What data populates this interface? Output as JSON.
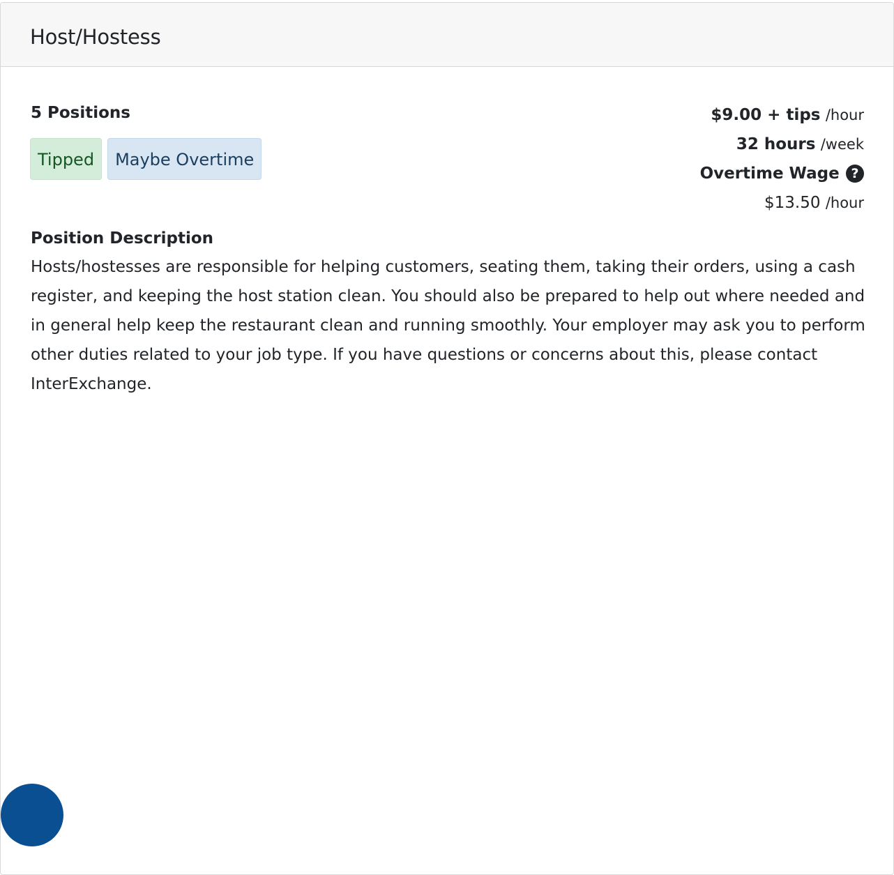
{
  "job": {
    "title": "Host/Hostess",
    "positions": "5 Positions",
    "badges": [
      "Tipped",
      "Maybe Overtime"
    ],
    "wage": {
      "amount": "$9.00 + tips",
      "unit": "/hour"
    },
    "hours": {
      "amount": "32 hours",
      "unit": "/week"
    },
    "overtime": {
      "label": "Overtime Wage",
      "help_icon": "question-circle-icon",
      "amount": "$13.50",
      "unit": "/hour"
    },
    "description": {
      "heading": "Position Description",
      "text": "Hosts/hostesses are responsible for helping customers, seating them, taking their orders, using a cash register, and keeping the host station clean. You should also be prepared to help out where needed and in general help keep the restaurant clean and running smoothly. Your employer may ask you to perform other duties related to your job type. If you have questions or concerns about this, please contact InterExchange."
    }
  },
  "colors": {
    "badge_tipped_bg": "#d4edda",
    "badge_overtime_bg": "#d8e6f3",
    "chat_bubble": "#0b4f93"
  }
}
